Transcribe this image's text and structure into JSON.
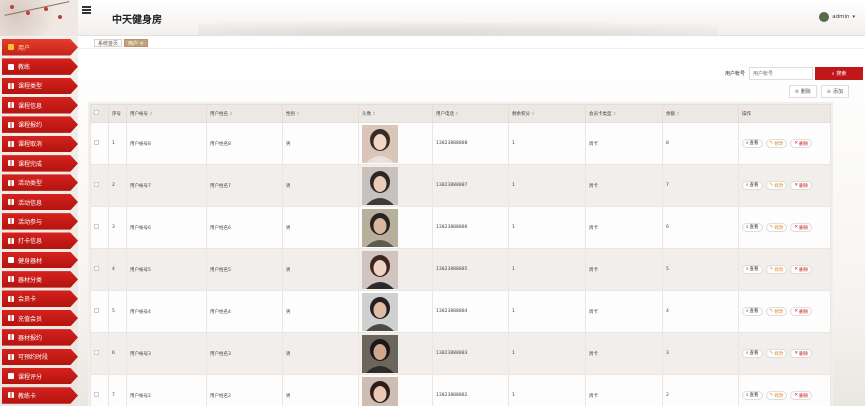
{
  "header": {
    "app_title": "中天健身房",
    "username": "admin",
    "caret": "▾"
  },
  "sidebar": {
    "items": [
      {
        "label": "用户",
        "active": true
      },
      {
        "label": "教练"
      },
      {
        "label": "课程类型"
      },
      {
        "label": "课程信息"
      },
      {
        "label": "课程报约"
      },
      {
        "label": "课程取消"
      },
      {
        "label": "课程完成"
      },
      {
        "label": "活动类型"
      },
      {
        "label": "活动信息"
      },
      {
        "label": "活动参与"
      },
      {
        "label": "打卡信息"
      },
      {
        "label": "健身器材"
      },
      {
        "label": "器材分类"
      },
      {
        "label": "会员卡"
      },
      {
        "label": "充值会员"
      },
      {
        "label": "器材报约"
      },
      {
        "label": "可预约时段"
      },
      {
        "label": "课程评分"
      },
      {
        "label": "教练卡"
      }
    ]
  },
  "tags": {
    "home": "系统首页",
    "current": "用户 ✕"
  },
  "search": {
    "label": "用户帐号",
    "placeholder": "用户帐号",
    "button": "搜索",
    "icon": "search-icon"
  },
  "actions": {
    "delete": "删除",
    "add": "添加"
  },
  "table": {
    "headers": [
      "序号",
      "用户帐号",
      "用户姓名",
      "性别",
      "头像",
      "用户电话",
      "剩余积分",
      "会员卡类型",
      "余额",
      "操作"
    ],
    "row_actions": {
      "view": "查看",
      "edit": "修改",
      "delete": "删除"
    },
    "rows": [
      {
        "index": "1",
        "account": "用户帐号8",
        "name": "用户姓名8",
        "gender": "男",
        "phone": "13823888888",
        "points": "1",
        "card": "周卡",
        "balance": "8"
      },
      {
        "index": "2",
        "account": "用户帐号7",
        "name": "用户姓名7",
        "gender": "男",
        "phone": "13823888887",
        "points": "1",
        "card": "周卡",
        "balance": "7"
      },
      {
        "index": "3",
        "account": "用户帐号6",
        "name": "用户姓名6",
        "gender": "男",
        "phone": "13823888886",
        "points": "1",
        "card": "周卡",
        "balance": "6"
      },
      {
        "index": "4",
        "account": "用户帐号5",
        "name": "用户姓名5",
        "gender": "男",
        "phone": "13823888885",
        "points": "1",
        "card": "周卡",
        "balance": "5"
      },
      {
        "index": "5",
        "account": "用户帐号4",
        "name": "用户姓名4",
        "gender": "男",
        "phone": "13823888884",
        "points": "1",
        "card": "周卡",
        "balance": "4"
      },
      {
        "index": "6",
        "account": "用户帐号3",
        "name": "用户姓名3",
        "gender": "男",
        "phone": "13823888883",
        "points": "1",
        "card": "周卡",
        "balance": "3"
      },
      {
        "index": "7",
        "account": "用户帐号2",
        "name": "用户姓名2",
        "gender": "男",
        "phone": "13823888882",
        "points": "1",
        "card": "周卡",
        "balance": "2"
      }
    ]
  },
  "colors": {
    "accent": "#c1171b",
    "sidebar_red": "#b3140f",
    "tag_active": "#c1a37a"
  }
}
